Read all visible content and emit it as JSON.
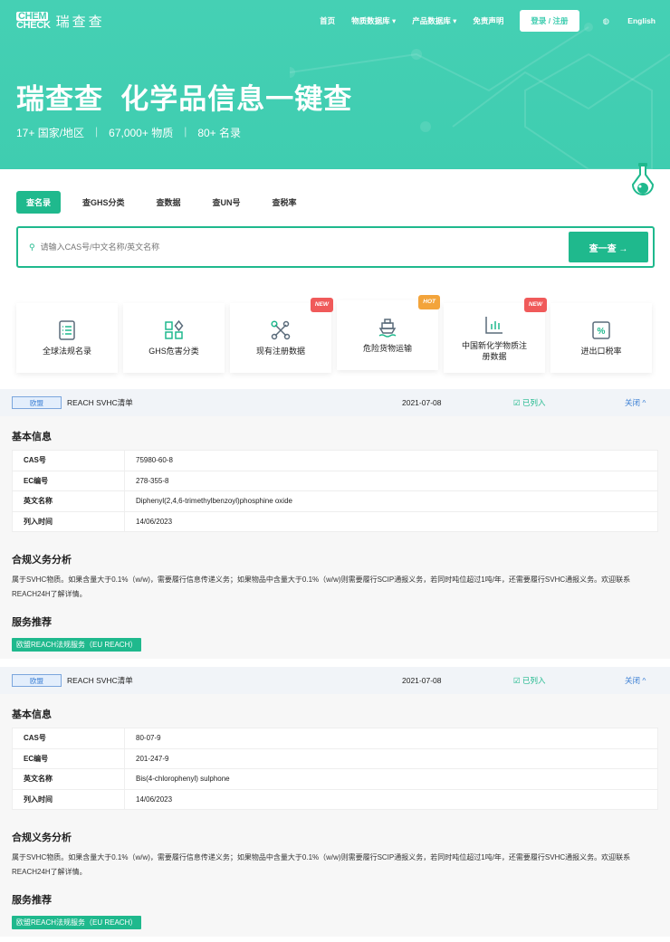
{
  "header": {
    "logo_top": "CHEM",
    "logo_bottom": "CHECK",
    "logo_cn": "瑞查查",
    "nav": [
      "首页",
      "物质数据库 ▾",
      "产品数据库 ▾",
      "免责声明"
    ],
    "login": "登录 / 注册",
    "lang": "English"
  },
  "hero": {
    "brand": "瑞查查",
    "slogan": "化学品信息一键查",
    "stats": [
      "17+ 国家/地区",
      "67,000+ 物质",
      "80+ 名录"
    ]
  },
  "tabs": [
    "查名录",
    "查GHS分类",
    "查数据",
    "查UN号",
    "查税率"
  ],
  "search": {
    "placeholder": "请输入CAS号/中文名称/英文名称",
    "button": "查一查 →"
  },
  "cards": [
    {
      "label": "全球法规名录"
    },
    {
      "label": "GHS危害分类"
    },
    {
      "label": "现有注册数据",
      "badge": "NEW"
    },
    {
      "label": "危险货物运输",
      "badge": "HOT"
    },
    {
      "label": "中国新化学物质注册数据",
      "badge": "NEW"
    },
    {
      "label": "进出口税率"
    }
  ],
  "colors": {
    "accent": "#1fb98d",
    "hero": "#42cfb2",
    "new": "#f05a5a",
    "hot": "#f3a43b"
  },
  "records": [
    {
      "region": "欧盟",
      "list": "REACH SVHC清单",
      "date": "2021-07-08",
      "status": "已列入",
      "close": "关闭 ^",
      "basic_title": "基本信息",
      "rows": [
        [
          "CAS号",
          "75980-60-8"
        ],
        [
          "EC编号",
          "278-355-8"
        ],
        [
          "英文名称",
          "Diphenyl(2,4,6-trimethylbenzoyl)phosphine oxide"
        ],
        [
          "列入时间",
          "14/06/2023"
        ]
      ],
      "analysis_title": "合规义务分析",
      "analysis": "属于SVHC物质。如果含量大于0.1%（w/w)，需要履行信息传递义务；如果物品中含量大于0.1%（w/w)则需要履行SCIP通报义务，若同时吨位超过1吨/年，还需要履行SVHC通报义务。欢迎联系REACH24H了解详情。",
      "service_title": "服务推荐",
      "service": "欧盟REACH法规服务（EU REACH）"
    },
    {
      "region": "欧盟",
      "list": "REACH SVHC清单",
      "date": "2021-07-08",
      "status": "已列入",
      "close": "关闭 ^",
      "basic_title": "基本信息",
      "rows": [
        [
          "CAS号",
          "80-07-9"
        ],
        [
          "EC编号",
          "201-247-9"
        ],
        [
          "英文名称",
          "Bis(4-chlorophenyl) sulphone"
        ],
        [
          "列入时间",
          "14/06/2023"
        ]
      ],
      "analysis_title": "合规义务分析",
      "analysis": "属于SVHC物质。如果含量大于0.1%（w/w)，需要履行信息传递义务；如果物品中含量大于0.1%（w/w)则需要履行SCIP通报义务，若同时吨位超过1吨/年，还需要履行SVHC通报义务。欢迎联系REACH24H了解详情。",
      "service_title": "服务推荐",
      "service": "欧盟REACH法规服务（EU REACH）"
    }
  ]
}
